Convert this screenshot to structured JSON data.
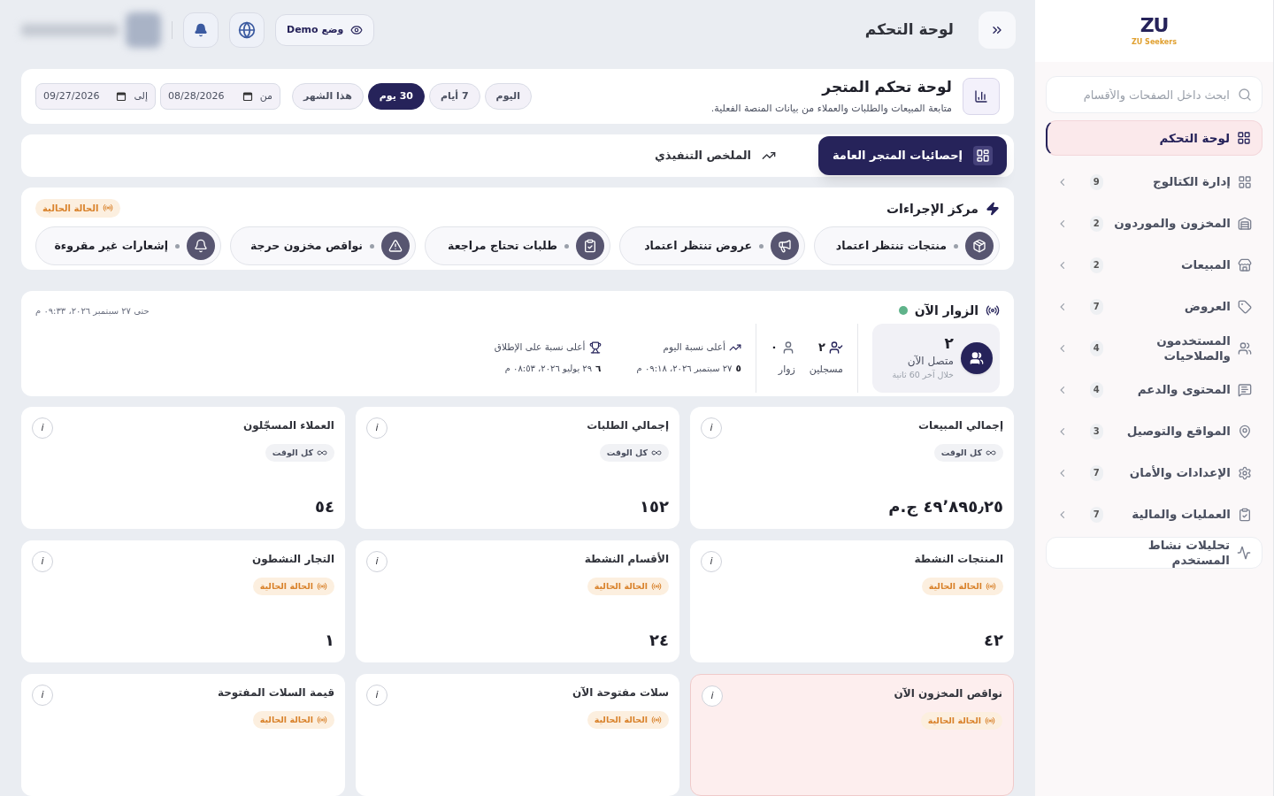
{
  "sidebar": {
    "logo": {
      "mark": "ZU",
      "caption": "ZU Seekers"
    },
    "search": {
      "placeholder": "ابحث داخل الصفحات والأقسام"
    },
    "items": [
      {
        "label": "لوحة التحكم",
        "selected": true
      },
      {
        "label": "إدارة الكتالوج",
        "count": "9",
        "selected": false
      },
      {
        "label": "المخزون والموردون",
        "count": "2",
        "selected": false
      },
      {
        "label": "المبيعات",
        "count": "2",
        "selected": false
      },
      {
        "label": "العروض",
        "count": "7",
        "selected": false
      },
      {
        "label": "المستخدمون والصلاحيات",
        "count": "4",
        "selected": false
      },
      {
        "label": "المحتوى والدعم",
        "count": "4",
        "selected": false
      },
      {
        "label": "المواقع والتوصيل",
        "count": "3",
        "selected": false
      },
      {
        "label": "الإعدادات والأمان",
        "count": "7",
        "selected": false
      },
      {
        "label": "العمليات والمالية",
        "count": "7",
        "selected": false
      },
      {
        "label": "تحليلات نشاط المستخدم",
        "selected": false
      }
    ]
  },
  "topbar": {
    "title": "لوحة التحكم",
    "demo_label": "وضع Demo"
  },
  "header": {
    "title": "لوحة تحكم المتجر",
    "subtitle": "متابعة المبيعات والطلبات والعملاء من بيانات المنصة الفعلية.",
    "periods": [
      {
        "label": "اليوم",
        "selected": false
      },
      {
        "label": "7 أيام",
        "selected": false
      },
      {
        "label": "30 يوم",
        "selected": true
      },
      {
        "label": "هذا الشهر",
        "selected": false
      }
    ],
    "from": {
      "label": "من",
      "value": "08/28/2026"
    },
    "to": {
      "label": "إلى",
      "value": "09/27/2026"
    }
  },
  "view_tabs": [
    {
      "label": "إحصائيات المتجر العامة",
      "selected": true
    },
    {
      "label": "الملخص التنفيذي",
      "selected": false
    }
  ],
  "actions": {
    "title": "مركز الإجراءات",
    "badge": "الحالة الحالية",
    "items": [
      {
        "label": "منتجات تنتظر اعتماد"
      },
      {
        "label": "عروض تنتظر اعتماد"
      },
      {
        "label": "طلبات تحتاج مراجعة"
      },
      {
        "label": "نواقص مخزون حرجة"
      },
      {
        "label": "إشعارات غير مقروءة"
      }
    ]
  },
  "visitors": {
    "title": "الزوار الآن",
    "live": true,
    "until": "حتى ٢٧ سبتمبر ٢٠٢٦، ٠٩:٣٣ م",
    "online_count": "٢",
    "online_label": "متصل الآن",
    "online_note": "خلال آخر 60 ثانية",
    "registered_count": "٢",
    "registered_label": "مسجلين",
    "guests_count": "٠",
    "guests_label": "زوار",
    "peaks": [
      {
        "label": "أعلى نسبة اليوم",
        "value": "٥",
        "date": "٢٧ سبتمبر ٢٠٢٦، ٠٩:١٨ م"
      },
      {
        "label": "أعلى نسبة على الإطلاق",
        "value": "٦",
        "date": "٢٩ يوليو ٢٠٢٦، ٠٨:٥٣ م"
      }
    ]
  },
  "stats": [
    {
      "title": "إجمالي المبيعات",
      "badge": {
        "kind": "all_time",
        "label": "كل الوقت"
      },
      "value": "٤٩٬٨٩٥٫٢٥ ج.م",
      "alert": false,
      "info": "i"
    },
    {
      "title": "إجمالي الطلبات",
      "badge": {
        "kind": "all_time",
        "label": "كل الوقت"
      },
      "value": "١٥٢",
      "alert": false,
      "info": "i"
    },
    {
      "title": "العملاء المسجّلون",
      "badge": {
        "kind": "all_time",
        "label": "كل الوقت"
      },
      "value": "٥٤",
      "alert": false,
      "info": "i"
    },
    {
      "title": "المنتجات النشطة",
      "badge": {
        "kind": "current",
        "label": "الحالة الحالية"
      },
      "value": "٤٢",
      "alert": false,
      "info": "i"
    },
    {
      "title": "الأقسام النشطة",
      "badge": {
        "kind": "current",
        "label": "الحالة الحالية"
      },
      "value": "٢٤",
      "alert": false,
      "info": "i"
    },
    {
      "title": "التجار النشطون",
      "badge": {
        "kind": "current",
        "label": "الحالة الحالية"
      },
      "value": "١",
      "alert": false,
      "info": "i"
    },
    {
      "title": "نواقص المخزون الآن",
      "badge": {
        "kind": "current",
        "label": "الحالة الحالية"
      },
      "alert": true,
      "info": "i"
    },
    {
      "title": "سلات مفتوحة الآن",
      "badge": {
        "kind": "current",
        "label": "الحالة الحالية"
      },
      "alert": false,
      "info": "i"
    },
    {
      "title": "قيمة السلات المفتوحة",
      "badge": {
        "kind": "current",
        "label": "الحالة الحالية"
      },
      "alert": false,
      "info": "i"
    }
  ]
}
